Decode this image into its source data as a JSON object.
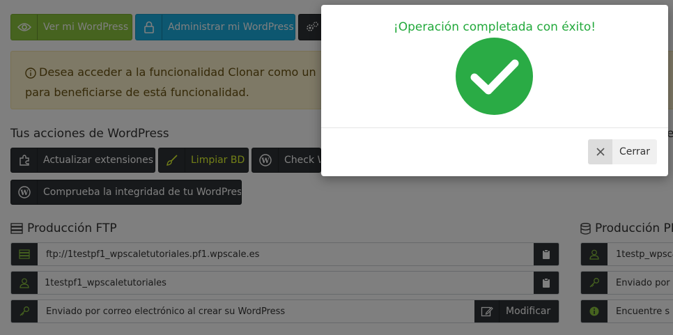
{
  "top_buttons": {
    "view_label": "Ver mi WordPress",
    "admin_label": "Administrar mi WordPress"
  },
  "alert": {
    "text": "Desea acceder a la funcionalidad Clonar como un",
    "text_line2": "para beneficiarse de está funcionalidad."
  },
  "actions": {
    "title": "Tus acciones de WordPress",
    "update_extensions": "Actualizar extensiones",
    "clean_db": "Limpiar BD",
    "check": "Check W",
    "integrity": "Comprueba la integridad de tu WordPress",
    "right_partial": "e"
  },
  "ftp": {
    "title": "Producción FTP",
    "host": "ftp://1testpf1_wpscaletutoriales.pf1.wpscale.es",
    "user": "1testpf1_wpscaletutoriales",
    "password_note": "Enviado por correo electrónico al crear su WordPress",
    "modify_label": "Modificar"
  },
  "php": {
    "title": "Producción PH",
    "user": "1testp_wpsca",
    "password_note": "Enviado por",
    "info_note": "Encuentre s"
  },
  "modal": {
    "title": "¡Operación completada con éxito!",
    "close_label": "Cerrar"
  },
  "colors": {
    "success": "#2aab45",
    "accent_green": "#8cc63f",
    "accent_blue": "#1bafe0",
    "dark": "#2f3336"
  }
}
